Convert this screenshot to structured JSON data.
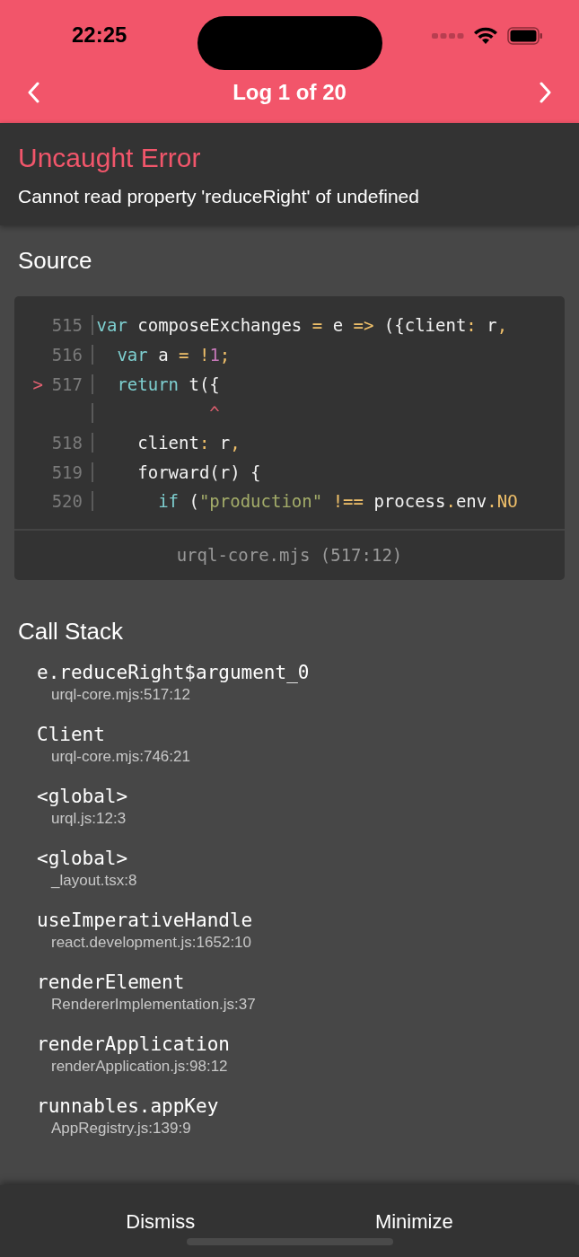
{
  "status_bar": {
    "time": "22:25"
  },
  "nav": {
    "title": "Log 1 of 20"
  },
  "error": {
    "title": "Uncaught Error",
    "message": "Cannot read property 'reduceRight' of undefined"
  },
  "source": {
    "title": "Source",
    "file": "urql-core.mjs (517:12)",
    "lines": [
      {
        "number": "515",
        "tokens": [
          {
            "kind": "keyword",
            "text": "var"
          },
          {
            "kind": "plain",
            "text": " composeExchanges "
          },
          {
            "kind": "operator",
            "text": "="
          },
          {
            "kind": "plain",
            "text": " e "
          },
          {
            "kind": "operator",
            "text": "=>"
          },
          {
            "kind": "plain",
            "text": " ({client"
          },
          {
            "kind": "operator",
            "text": ":"
          },
          {
            "kind": "plain",
            "text": " r"
          },
          {
            "kind": "operator",
            "text": ","
          }
        ]
      },
      {
        "number": "516",
        "tokens": [
          {
            "kind": "keyword",
            "text": "  var"
          },
          {
            "kind": "plain",
            "text": " a "
          },
          {
            "kind": "operator",
            "text": "="
          },
          {
            "kind": "operator",
            "text": " !"
          },
          {
            "kind": "number",
            "text": "1"
          },
          {
            "kind": "operator",
            "text": ";"
          }
        ]
      },
      {
        "number": "517",
        "marker": ">",
        "tokens": [
          {
            "kind": "keyword",
            "text": "  return"
          },
          {
            "kind": "plain",
            "text": " t({"
          }
        ]
      },
      {
        "tokens": [
          {
            "kind": "caret",
            "text": "           ^"
          }
        ]
      },
      {
        "number": "518",
        "tokens": [
          {
            "kind": "plain",
            "text": "    client"
          },
          {
            "kind": "operator",
            "text": ":"
          },
          {
            "kind": "plain",
            "text": " r"
          },
          {
            "kind": "operator",
            "text": ","
          }
        ]
      },
      {
        "number": "519",
        "tokens": [
          {
            "kind": "plain",
            "text": "    forward(r) {"
          }
        ]
      },
      {
        "number": "520",
        "tokens": [
          {
            "kind": "keyword",
            "text": "      if"
          },
          {
            "kind": "plain",
            "text": " ("
          },
          {
            "kind": "string",
            "text": "\"production\""
          },
          {
            "kind": "operator",
            "text": " !=="
          },
          {
            "kind": "plain",
            "text": " process"
          },
          {
            "kind": "operator",
            "text": "."
          },
          {
            "kind": "plain",
            "text": "env"
          },
          {
            "kind": "operator",
            "text": "."
          },
          {
            "kind": "operator",
            "text": "NO"
          }
        ]
      }
    ]
  },
  "call_stack": {
    "title": "Call Stack",
    "frames": [
      {
        "function": "e.reduceRight$argument_0",
        "location": "urql-core.mjs:517:12"
      },
      {
        "function": "Client",
        "location": "urql-core.mjs:746:21"
      },
      {
        "function": "<global>",
        "location": "urql.js:12:3"
      },
      {
        "function": "<global>",
        "location": "_layout.tsx:8"
      },
      {
        "function": "useImperativeHandle",
        "location": "react.development.js:1652:10"
      },
      {
        "function": "renderElement",
        "location": "RendererImplementation.js:37"
      },
      {
        "function": "renderApplication",
        "location": "renderApplication.js:98:12"
      },
      {
        "function": "runnables.appKey",
        "location": "AppRegistry.js:139:9"
      }
    ]
  },
  "footer": {
    "buttons": [
      "Dismiss",
      "Minimize"
    ]
  }
}
